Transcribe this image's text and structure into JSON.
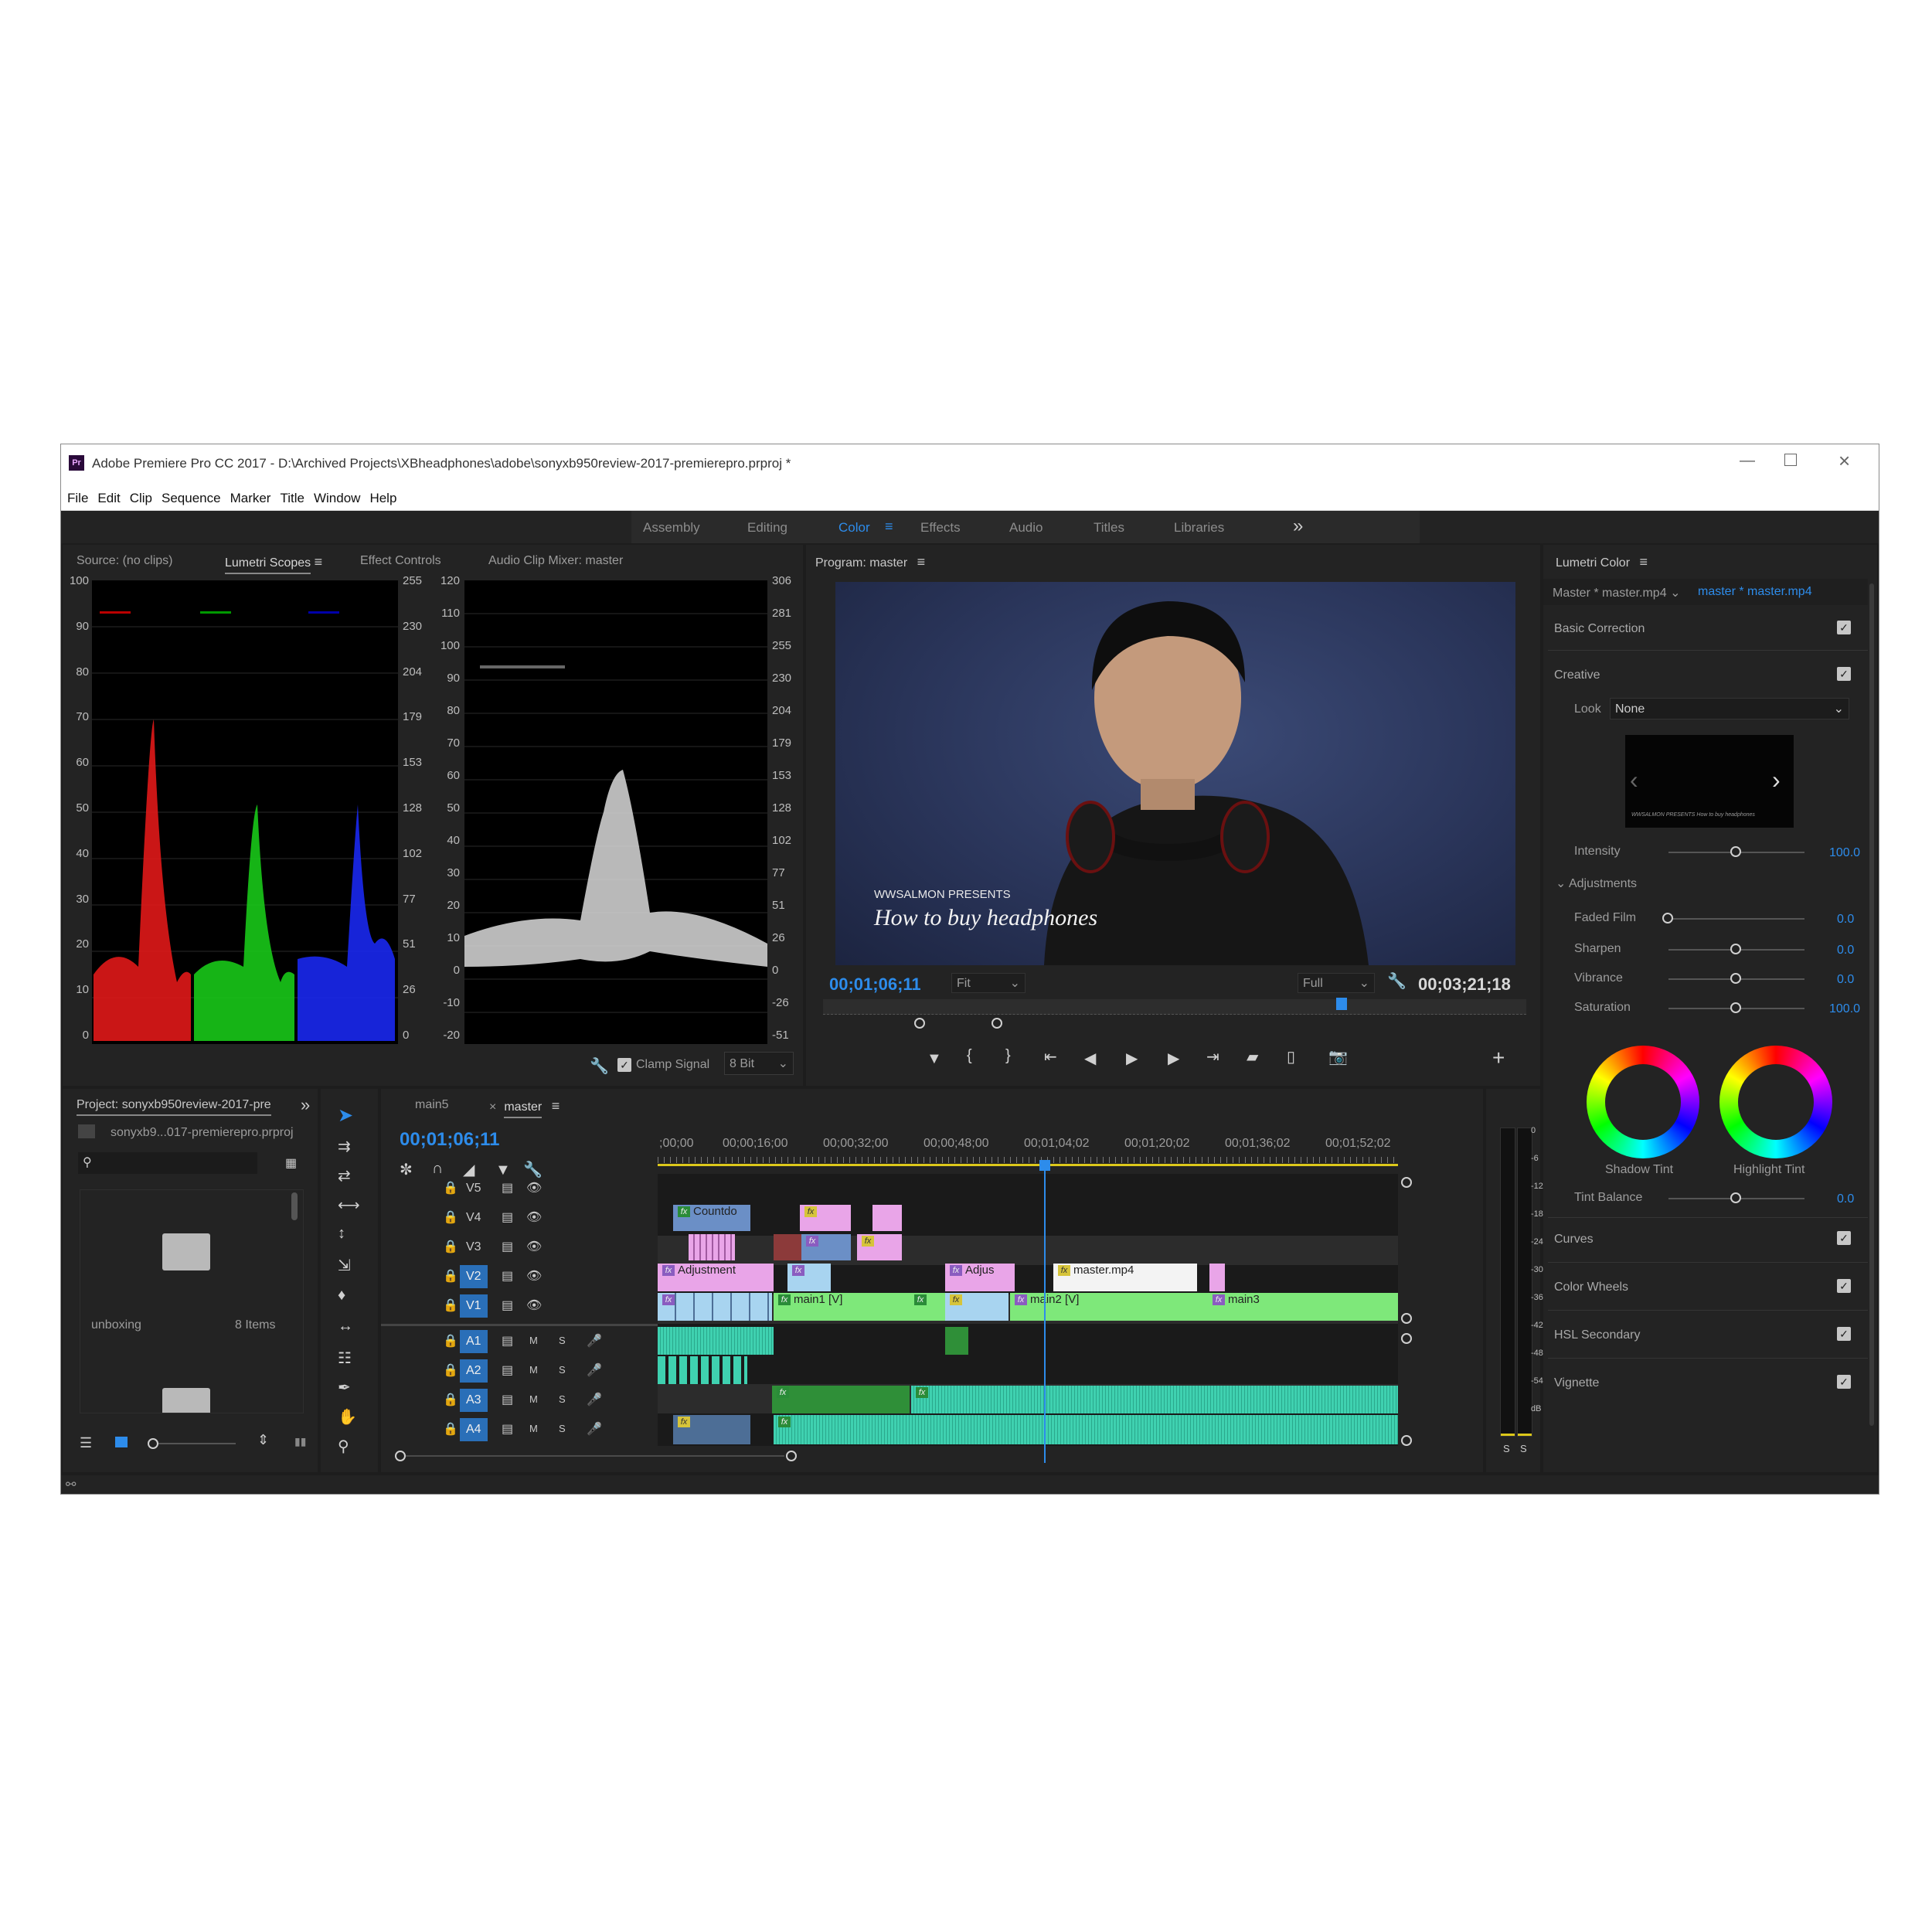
{
  "app": {
    "title": "Adobe Premiere Pro CC 2017 - D:\\Archived Projects\\XBheadphones\\adobe\\sonyxb950review-2017-premierepro.prproj *",
    "logo": "Pr"
  },
  "menu": [
    "File",
    "Edit",
    "Clip",
    "Sequence",
    "Marker",
    "Title",
    "Window",
    "Help"
  ],
  "workspaces": {
    "items": [
      "Assembly",
      "Editing",
      "Color",
      "Effects",
      "Audio",
      "Titles",
      "Libraries"
    ],
    "active": "Color",
    "more": "»"
  },
  "source_panel": {
    "tabs": [
      "Source: (no clips)",
      "Lumetri Scopes",
      "Effect Controls",
      "Audio Clip Mixer: master"
    ],
    "active_tab": "Lumetri Scopes",
    "parade_left_axis": [
      "100",
      "90",
      "80",
      "70",
      "60",
      "50",
      "40",
      "30",
      "20",
      "10",
      "0"
    ],
    "parade_right_axis": [
      "255",
      "230",
      "204",
      "179",
      "153",
      "128",
      "102",
      "77",
      "51",
      "26",
      "0"
    ],
    "wave_left_axis": [
      "120",
      "110",
      "100",
      "90",
      "80",
      "70",
      "60",
      "50",
      "40",
      "30",
      "20",
      "10",
      "0",
      "-10",
      "-20"
    ],
    "wave_right_axis": [
      "306",
      "281",
      "255",
      "230",
      "204",
      "179",
      "153",
      "128",
      "102",
      "77",
      "51",
      "26",
      "0",
      "-26",
      "-51"
    ],
    "clamp_signal": "Clamp Signal",
    "bit_depth": "8 Bit"
  },
  "program": {
    "title": "Program: master",
    "overlay_line1": "WWSALMON PRESENTS",
    "overlay_line2": "How to buy headphones",
    "timecode": "00;01;06;11",
    "fit": "Fit",
    "quality": "Full",
    "duration": "00;03;21;18",
    "playhead_fraction": 0.73
  },
  "lumetri": {
    "title": "Lumetri Color",
    "master_label": "Master * master.mp4",
    "clip_label": "master * master.mp4",
    "sections": {
      "basic": "Basic Correction",
      "creative": "Creative",
      "curves": "Curves",
      "wheels": "Color Wheels",
      "hsl": "HSL Secondary",
      "vignette": "Vignette"
    },
    "look_label": "Look",
    "look_value": "None",
    "preview_line1": "WWSALMON PRESENTS",
    "preview_line2": "How to buy headphones",
    "intensity": {
      "label": "Intensity",
      "value": "100.0",
      "fraction": 0.5
    },
    "adjustments": "Adjustments",
    "faded_film": {
      "label": "Faded Film",
      "value": "0.0",
      "fraction": 0.0
    },
    "sharpen": {
      "label": "Sharpen",
      "value": "0.0",
      "fraction": 0.5
    },
    "vibrance": {
      "label": "Vibrance",
      "value": "0.0",
      "fraction": 0.5
    },
    "saturation": {
      "label": "Saturation",
      "value": "100.0",
      "fraction": 0.5
    },
    "shadow_tint": "Shadow Tint",
    "highlight_tint": "Highlight Tint",
    "tint_balance": {
      "label": "Tint Balance",
      "value": "0.0",
      "fraction": 0.5
    }
  },
  "project": {
    "title": "Project: sonyxb950review-2017-pre",
    "file": "sonyxb9...017-premierepro.prproj",
    "folder_name": "unboxing",
    "folder_count": "8 Items"
  },
  "timeline": {
    "tabs": [
      "main5",
      "master"
    ],
    "active_tab": "master",
    "timecode": "00;01;06;11",
    "ruler": [
      ";00;00",
      "00;00;16;00",
      "00;00;32;00",
      "00;00;48;00",
      "00;01;04;02",
      "00;01;20;02",
      "00;01;36;02",
      "00;01;52;02"
    ],
    "video_tracks": [
      "V5",
      "V4",
      "V3",
      "V2",
      "V1"
    ],
    "audio_tracks": [
      "A1",
      "A2",
      "A3",
      "A4"
    ],
    "clips": {
      "countdown": "Countdo",
      "adjustment": "Adjustment",
      "adju": "Adjus",
      "master": "master.mp4",
      "main1": "main1 [V]",
      "main2": "main2 [V]",
      "main3": "main3"
    },
    "meter_scale": [
      "0",
      "-6",
      "-12",
      "-18",
      "-24",
      "-30",
      "-36",
      "-42",
      "-48",
      "-54",
      "dB"
    ],
    "solo": [
      "S",
      "S"
    ]
  },
  "colors": {
    "accent": "#2d8ceb",
    "v_clip": "#e9a5e8",
    "v1_clip": "#7ee87a",
    "audio_clip": "#3fd1b0",
    "video_blue": "#a8d4f0"
  }
}
